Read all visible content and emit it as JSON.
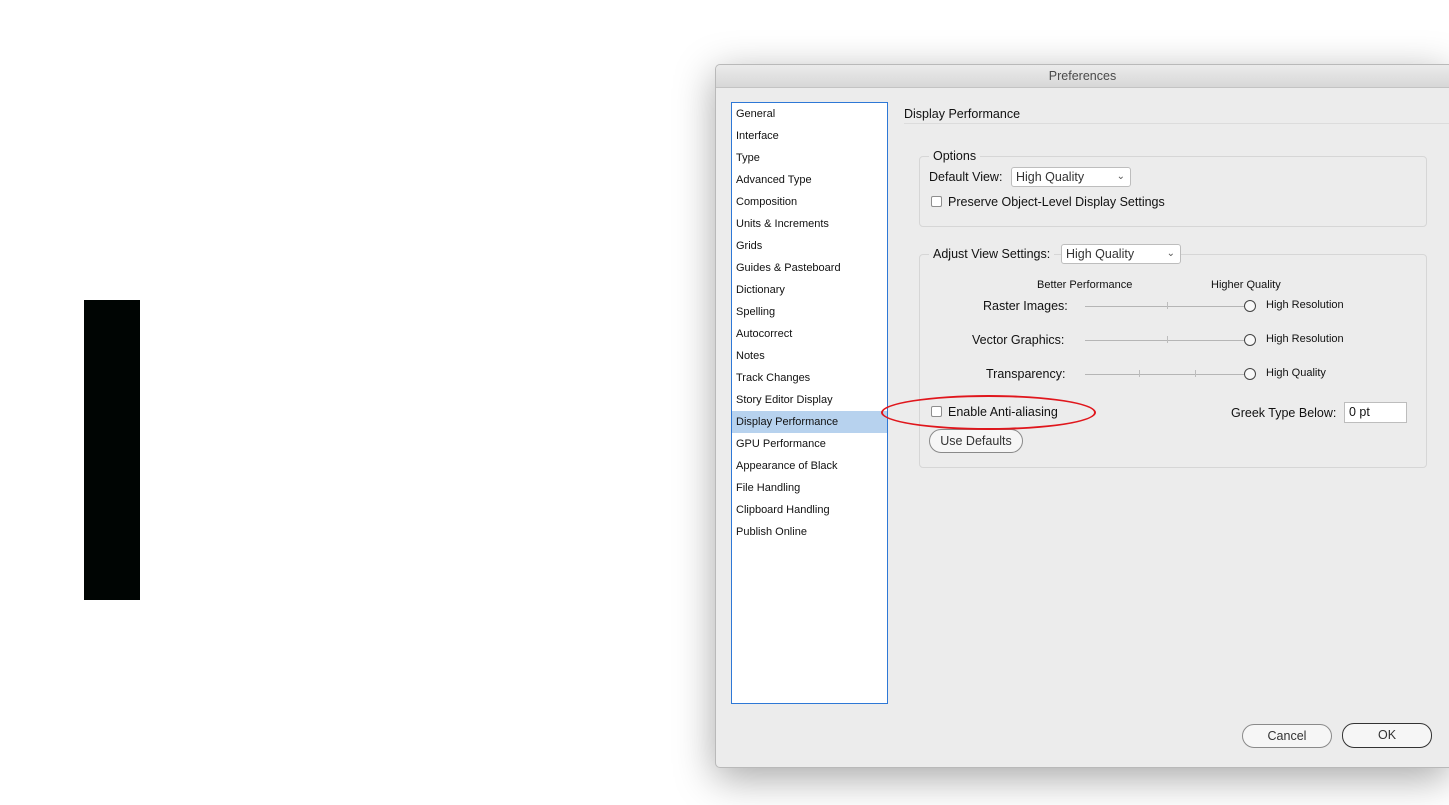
{
  "window": {
    "title": "Preferences"
  },
  "sidebar": {
    "items": [
      {
        "label": "General"
      },
      {
        "label": "Interface"
      },
      {
        "label": "Type"
      },
      {
        "label": "Advanced Type"
      },
      {
        "label": "Composition"
      },
      {
        "label": "Units & Increments"
      },
      {
        "label": "Grids"
      },
      {
        "label": "Guides & Pasteboard"
      },
      {
        "label": "Dictionary"
      },
      {
        "label": "Spelling"
      },
      {
        "label": "Autocorrect"
      },
      {
        "label": "Notes"
      },
      {
        "label": "Track Changes"
      },
      {
        "label": "Story Editor Display"
      },
      {
        "label": "Display Performance"
      },
      {
        "label": "GPU Performance"
      },
      {
        "label": "Appearance of Black"
      },
      {
        "label": "File Handling"
      },
      {
        "label": "Clipboard Handling"
      },
      {
        "label": "Publish Online"
      }
    ],
    "selected": "Display Performance"
  },
  "section": {
    "title": "Display Performance"
  },
  "options": {
    "legend": "Options",
    "default_view_label": "Default View:",
    "default_view_value": "High Quality",
    "preserve_label": "Preserve Object-Level Display Settings",
    "preserve_checked": false
  },
  "adjust": {
    "legend": "Adjust View Settings:",
    "value": "High Quality",
    "better_performance": "Better Performance",
    "higher_quality": "Higher Quality",
    "sliders": [
      {
        "label": "Raster Images:",
        "value_label": "High Resolution",
        "level": 1.0
      },
      {
        "label": "Vector Graphics:",
        "value_label": "High Resolution",
        "level": 1.0
      },
      {
        "label": "Transparency:",
        "value_label": "High Quality",
        "level": 1.0
      }
    ],
    "antialias_label": "Enable Anti-aliasing",
    "antialias_checked": false,
    "greek_label": "Greek Type Below:",
    "greek_value": "0 pt",
    "use_defaults": "Use Defaults"
  },
  "footer": {
    "cancel": "Cancel",
    "ok": "OK"
  },
  "colors": {
    "selection": "#b7d2ee",
    "focus_border": "#2e78d6",
    "annotation": "#e0161c"
  }
}
